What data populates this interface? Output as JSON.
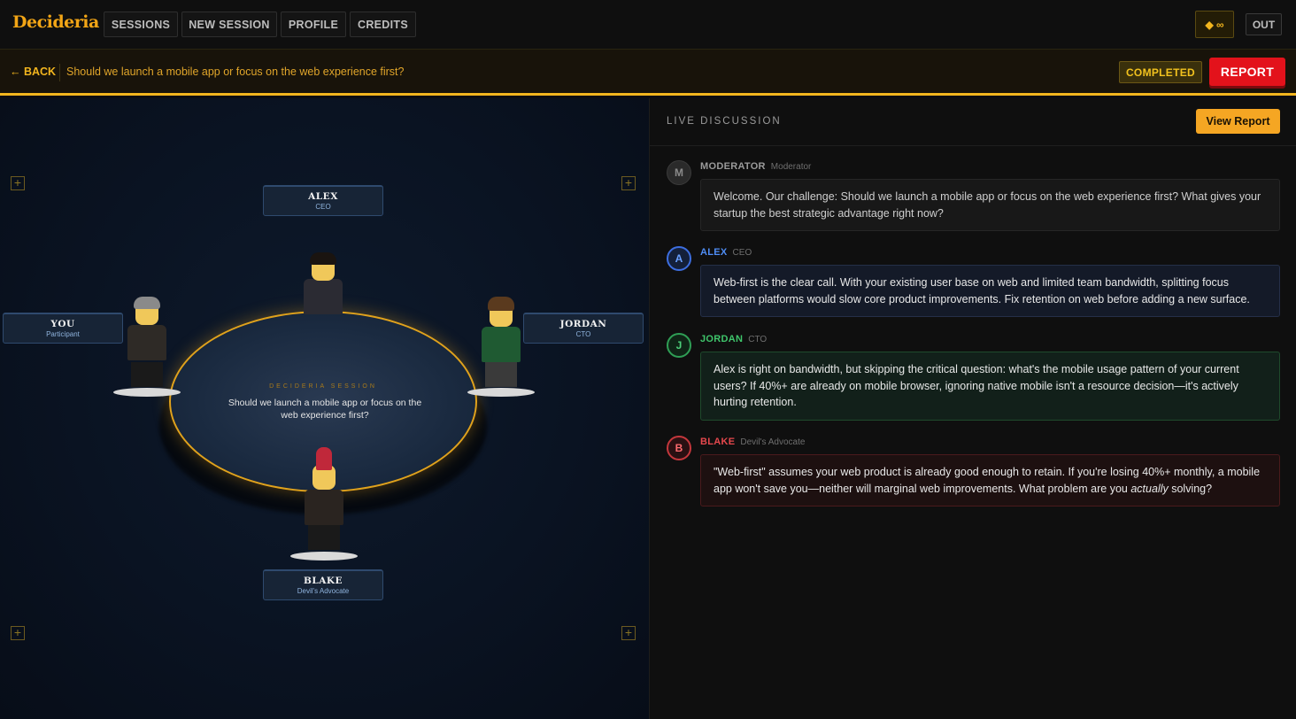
{
  "app": {
    "brand": "Decideria",
    "nav": [
      "SESSIONS",
      "NEW SESSION",
      "PROFILE",
      "CREDITS"
    ],
    "credits_badge": "◆ ∞",
    "out_label": "OUT"
  },
  "session": {
    "back_label": "← BACK",
    "question": "Should we launch a mobile app or focus on the web experience first?",
    "status": "COMPLETED",
    "report_label": "REPORT"
  },
  "stage": {
    "table_title": "DECIDERIA SESSION",
    "table_question": "Should we launch a mobile app or focus on the web experience first?",
    "seats": [
      {
        "name": "ALEX",
        "role": "CEO"
      },
      {
        "name": "YOU",
        "role": "Participant"
      },
      {
        "name": "JORDAN",
        "role": "CTO"
      },
      {
        "name": "BLAKE",
        "role": "Devil's Advocate"
      }
    ],
    "colors": {
      "table_border": "#e0a21c",
      "seat_bg": "#172436"
    }
  },
  "discussion": {
    "title": "LIVE DISCUSSION",
    "view_report_label": "View Report",
    "messages": [
      {
        "initial": "M",
        "name": "MODERATOR",
        "role": "Moderator",
        "text": "Welcome. Our challenge: Should we launch a mobile app or focus on the web experience first? What gives your startup the best strategic advantage right now?",
        "color": "#9a9a9a"
      },
      {
        "initial": "A",
        "name": "ALEX",
        "role": "CEO",
        "text": "Web-first is the clear call. With your existing user base on web and limited team bandwidth, splitting focus between platforms would slow core product improvements. Fix retention on web before adding a new surface.",
        "color": "#4f8df5"
      },
      {
        "initial": "J",
        "name": "JORDAN",
        "role": "CTO",
        "text": "Alex is right on bandwidth, but skipping the critical question: what's the mobile usage pattern of your current users? If 40%+ are already on mobile browser, ignoring native mobile isn't a resource decision—it's actively hurting retention.",
        "color": "#3fc56b"
      },
      {
        "initial": "B",
        "name": "BLAKE",
        "role": "Devil's Advocate",
        "text_before": "\"Web-first\" assumes your web product is already good enough to retain. If you're losing 40%+ monthly, a mobile app won't save you—neither will marginal web improvements. What problem are you ",
        "text_em": "actually",
        "text_after": " solving?",
        "color": "#e5484d"
      }
    ]
  }
}
